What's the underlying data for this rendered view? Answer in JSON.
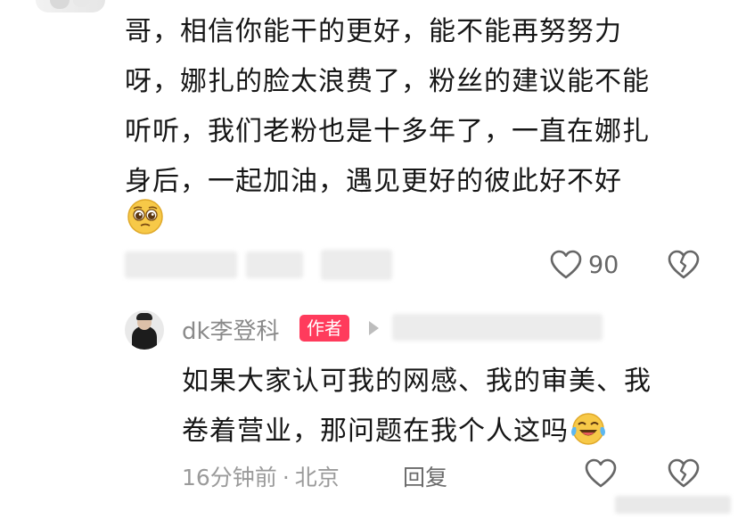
{
  "comment": {
    "lines": [
      "哥，相信你能干的更好，能不能再努努力",
      "呀，娜扎的脸太浪费了，粉丝的建议能不能",
      "听听，我们老粉也是十多年了，一直在娜扎",
      "身后，一起加油，遇见更好的彼此好不好"
    ],
    "emoji_icon": "pleading-face-icon",
    "like_count": "90"
  },
  "reply": {
    "username": "dk李登科",
    "author_badge": "作者",
    "lines": [
      "如果大家认可我的网感、我的审美、我",
      "卷着营业，那问题在我个人这吗"
    ],
    "emoji_icon": "laughing-crying-face-icon",
    "time": "16分钟前",
    "separator": "·",
    "location": "北京",
    "reply_label": "回复"
  },
  "colors": {
    "badge": "#ff3b5c",
    "text": "#161616",
    "meta": "#9a9a9a"
  }
}
